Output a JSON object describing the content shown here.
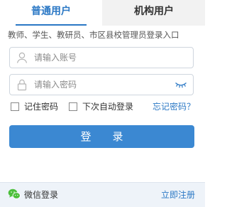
{
  "tabs": {
    "common": "普通用户",
    "org": "机构用户"
  },
  "subtitle": "教师、学生、教研员、市区县校管理员登录入口",
  "username": {
    "placeholder": "请输入账号",
    "value": ""
  },
  "password": {
    "placeholder": "请输入密码",
    "value": ""
  },
  "options": {
    "remember": "记住密码",
    "auto_login": "下次自动登录",
    "forgot": "忘记密码？"
  },
  "login_label": "登录",
  "footer": {
    "wechat": "微信登录",
    "register": "立即注册"
  },
  "colors": {
    "accent": "#2b78c5",
    "button": "#3b88d2",
    "wechat": "#4cbf3b"
  },
  "icons": {
    "username": "user-icon",
    "password": "lock-icon",
    "toggle": "eye-closed-icon",
    "wechat": "wechat-icon"
  }
}
